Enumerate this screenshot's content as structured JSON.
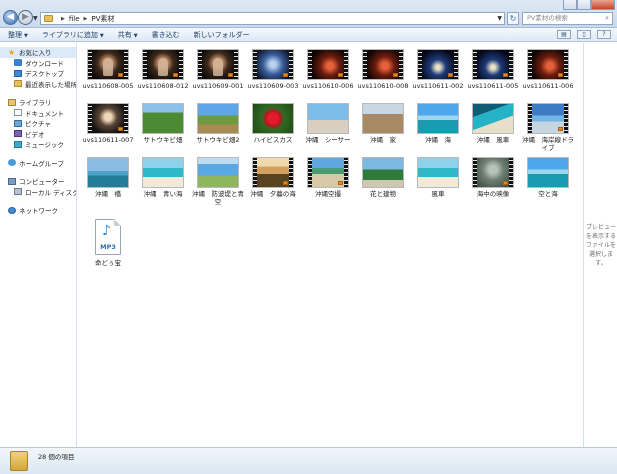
{
  "address": {
    "segments": [
      "file",
      "PV素材"
    ],
    "search_placeholder": "PV素材の検索"
  },
  "toolbar": {
    "items": [
      "整理",
      "ライブラリに追加",
      "共有",
      "書き込む",
      "新しいフォルダー"
    ]
  },
  "sidebar": {
    "favorites": {
      "label": "お気に入り",
      "items": [
        "ダウンロード",
        "デスクトップ",
        "最近表示した場所"
      ]
    },
    "libraries": {
      "label": "ライブラリ",
      "items": [
        "ドキュメント",
        "ピクチャ",
        "ビデオ",
        "ミュージック"
      ]
    },
    "homegroup": "ホームグループ",
    "computer": {
      "label": "コンピューター",
      "items": [
        "ローカル ディスク (C"
      ]
    },
    "network": "ネットワーク"
  },
  "files": [
    {
      "name": "uvs110608-005",
      "kind": "video",
      "scene": "dark-stage",
      "person": true
    },
    {
      "name": "uvs110608-012",
      "kind": "video",
      "scene": "dark-stage",
      "person": true
    },
    {
      "name": "uvs110609-001",
      "kind": "video",
      "scene": "dark-stage",
      "person": true
    },
    {
      "name": "uvs110609-003",
      "kind": "video",
      "scene": "stage-blue"
    },
    {
      "name": "uvs110610-006",
      "kind": "video",
      "scene": "night-red"
    },
    {
      "name": "uvs110610-008",
      "kind": "video",
      "scene": "night-red"
    },
    {
      "name": "uvs110611-002",
      "kind": "video",
      "scene": "night-blue"
    },
    {
      "name": "uvs110611-005",
      "kind": "video",
      "scene": "night-blue"
    },
    {
      "name": "uvs110611-006",
      "kind": "video",
      "scene": "night-red"
    },
    {
      "name": "uvs110611-007",
      "kind": "video",
      "scene": "dark-stage2"
    },
    {
      "name": "サトウキビ畑",
      "kind": "image",
      "scene": "green"
    },
    {
      "name": "サトウキビ畑2",
      "kind": "image",
      "scene": "field"
    },
    {
      "name": "ハイビスカス",
      "kind": "image",
      "scene": "flower"
    },
    {
      "name": "沖縄　シーサー",
      "kind": "image",
      "scene": "tower"
    },
    {
      "name": "沖縄　家",
      "kind": "image",
      "scene": "building"
    },
    {
      "name": "沖縄　海",
      "kind": "image",
      "scene": "blue-sea"
    },
    {
      "name": "沖縄　風車",
      "kind": "image",
      "scene": "cove"
    },
    {
      "name": "沖縄　海岸線ドライブ",
      "kind": "video",
      "scene": "shore"
    },
    {
      "name": "沖縄　橋",
      "kind": "image",
      "scene": "bridge"
    },
    {
      "name": "沖縄　青い海",
      "kind": "image",
      "scene": "beach"
    },
    {
      "name": "沖縄　防波堤と青空",
      "kind": "image",
      "scene": "clouds"
    },
    {
      "name": "沖縄　夕暮の海",
      "kind": "video",
      "scene": "evening"
    },
    {
      "name": "沖縄空撮",
      "kind": "video",
      "scene": "sand"
    },
    {
      "name": "花と建物",
      "kind": "image",
      "scene": "flowerbuild"
    },
    {
      "name": "風車",
      "kind": "image",
      "scene": "beach"
    },
    {
      "name": "海中の映像",
      "kind": "video",
      "scene": "underwater"
    },
    {
      "name": "空と海",
      "kind": "image",
      "scene": "blue-sea"
    },
    {
      "name": "命どぅ宝",
      "kind": "audio",
      "label": "MP3"
    }
  ],
  "preview": {
    "text": "プレビューを表示するファイルを選択します。"
  },
  "status": {
    "count": "28 個の項目"
  }
}
